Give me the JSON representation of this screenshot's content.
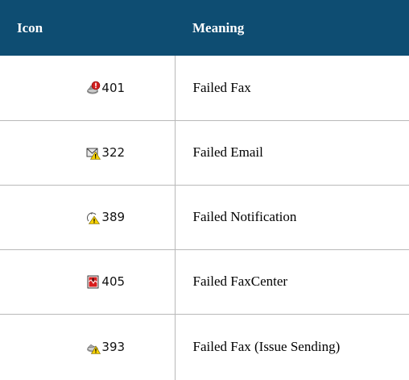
{
  "header": {
    "icon_col": "Icon",
    "meaning_col": "Meaning"
  },
  "rows": [
    {
      "icon": "failed-fax-icon",
      "count": "401",
      "meaning": "Failed Fax"
    },
    {
      "icon": "failed-email-icon",
      "count": "322",
      "meaning": "Failed Email"
    },
    {
      "icon": "failed-notification-icon",
      "count": "389",
      "meaning": "Failed Notification"
    },
    {
      "icon": "failed-faxcenter-icon",
      "count": "405",
      "meaning": "Failed FaxCenter"
    },
    {
      "icon": "failed-fax-issue-sending-icon",
      "count": "393",
      "meaning": "Failed Fax (Issue Sending)"
    }
  ],
  "colors": {
    "header_bg": "#0e4d72",
    "header_text": "#ffffff",
    "rule": "#b9b9b9"
  }
}
